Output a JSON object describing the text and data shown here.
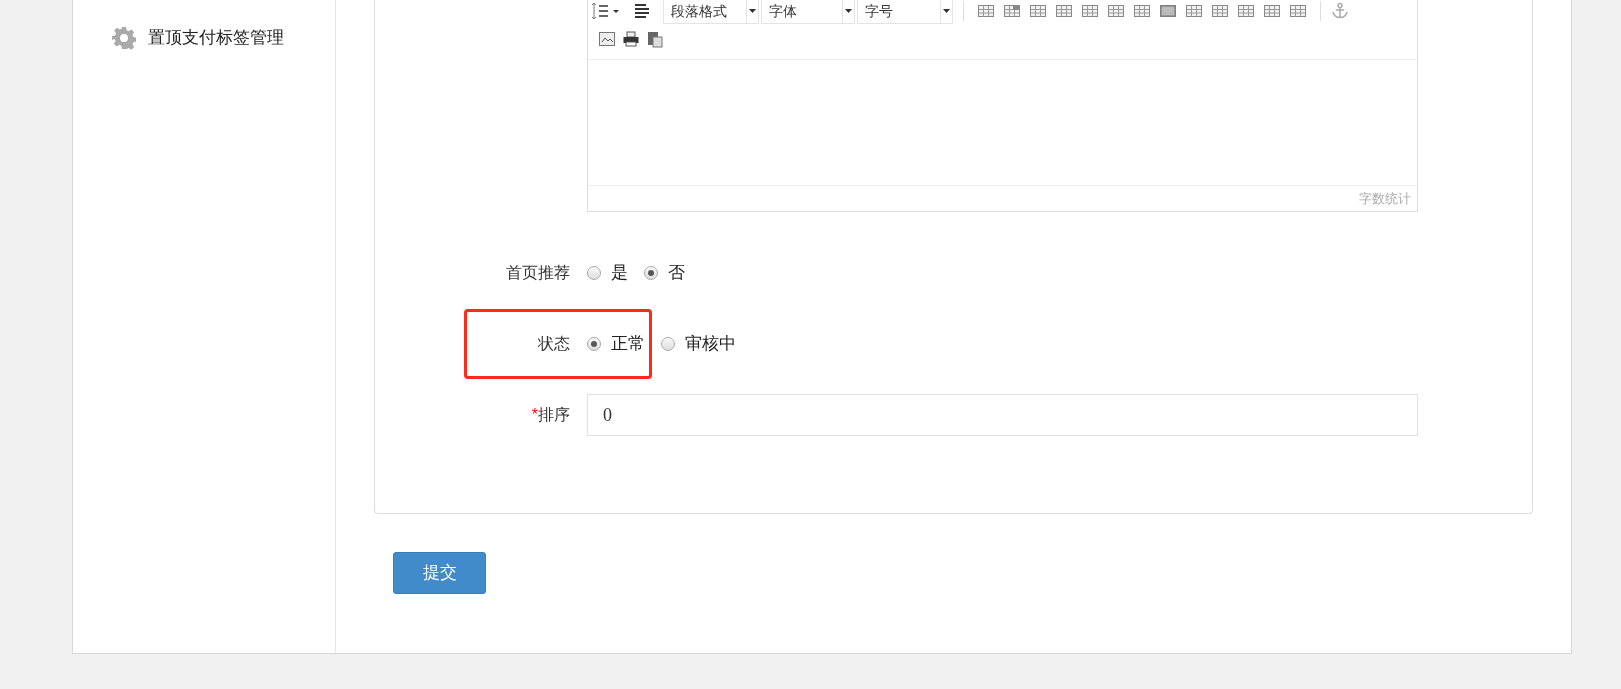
{
  "sidebar": {
    "items": [
      {
        "label": "置顶支付标签管理"
      }
    ]
  },
  "editor": {
    "dropdowns": [
      {
        "label": "段落格式"
      },
      {
        "label": "字体"
      },
      {
        "label": "字号"
      }
    ],
    "word_count": "字数统计"
  },
  "form": {
    "fields": [
      {
        "kind": "radio",
        "label": "首页推荐",
        "required": false,
        "options": [
          {
            "label": "是",
            "selected": false
          },
          {
            "label": "否",
            "selected": true
          }
        ]
      },
      {
        "kind": "radio",
        "label": "状态",
        "required": false,
        "highlighted": true,
        "options": [
          {
            "label": "正常",
            "selected": true
          },
          {
            "label": "审核中",
            "selected": false
          }
        ]
      },
      {
        "kind": "text",
        "label": "排序",
        "required": true,
        "required_mark": "*",
        "value": "0"
      }
    ]
  },
  "submit": "提交"
}
